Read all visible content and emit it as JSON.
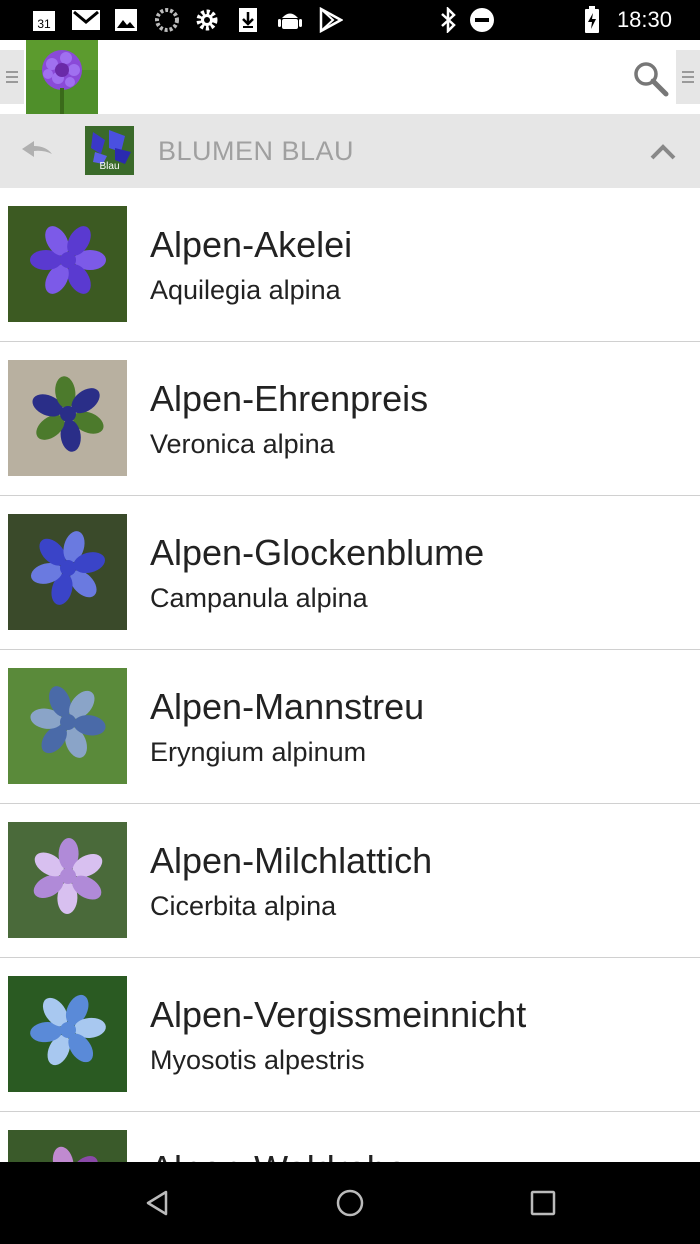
{
  "status_bar": {
    "time": "18:30",
    "calendar_day": "31",
    "icons": [
      "calendar-icon",
      "gmail-icon",
      "image-icon",
      "loading-icon",
      "settings-icon",
      "download-icon",
      "android-icon",
      "play-store-icon",
      "bluetooth-icon",
      "do-not-disturb-icon",
      "battery-charging-icon"
    ]
  },
  "app_bar": {
    "logo": "app-logo-flower",
    "left_menu_icon": "drawer-handle-icon",
    "search_icon": "search-icon",
    "right_menu_icon": "drawer-handle-icon"
  },
  "category": {
    "title": "BLUMEN BLAU",
    "thumb_label": "Blau",
    "back_icon": "back-arrow-icon",
    "collapse_icon": "chevron-up-icon"
  },
  "flowers": [
    {
      "name": "Alpen-Akelei",
      "latin": "Aquilegia alpina",
      "colors": [
        "#3c5a22",
        "#5a3ad0",
        "#7c5ae8"
      ]
    },
    {
      "name": "Alpen-Ehrenpreis",
      "latin": "Veronica alpina",
      "colors": [
        "#b8b0a0",
        "#2a2e88",
        "#4c7a2c"
      ]
    },
    {
      "name": "Alpen-Glockenblume",
      "latin": "Campanula alpina",
      "colors": [
        "#3a4a2a",
        "#3a44c8",
        "#6a7ae0"
      ]
    },
    {
      "name": "Alpen-Mannstreu",
      "latin": "Eryngium alpinum",
      "colors": [
        "#5a8a3a",
        "#4a6aa8",
        "#8aa4c8"
      ]
    },
    {
      "name": "Alpen-Milchlattich",
      "latin": "Cicerbita alpina",
      "colors": [
        "#4a6a3a",
        "#b08ad8",
        "#d8c0f0"
      ]
    },
    {
      "name": "Alpen-Vergissmeinnicht",
      "latin": "Myosotis alpestris",
      "colors": [
        "#2a5a22",
        "#5a8ad8",
        "#a8c8f0"
      ]
    },
    {
      "name": "Alpen-Waldrebe",
      "latin": "",
      "colors": [
        "#3a5a2a",
        "#8a4aa8",
        "#c08ad0"
      ]
    }
  ],
  "nav_bar": {
    "back_icon": "nav-back-icon",
    "home_icon": "nav-home-icon",
    "recents_icon": "nav-recents-icon"
  }
}
